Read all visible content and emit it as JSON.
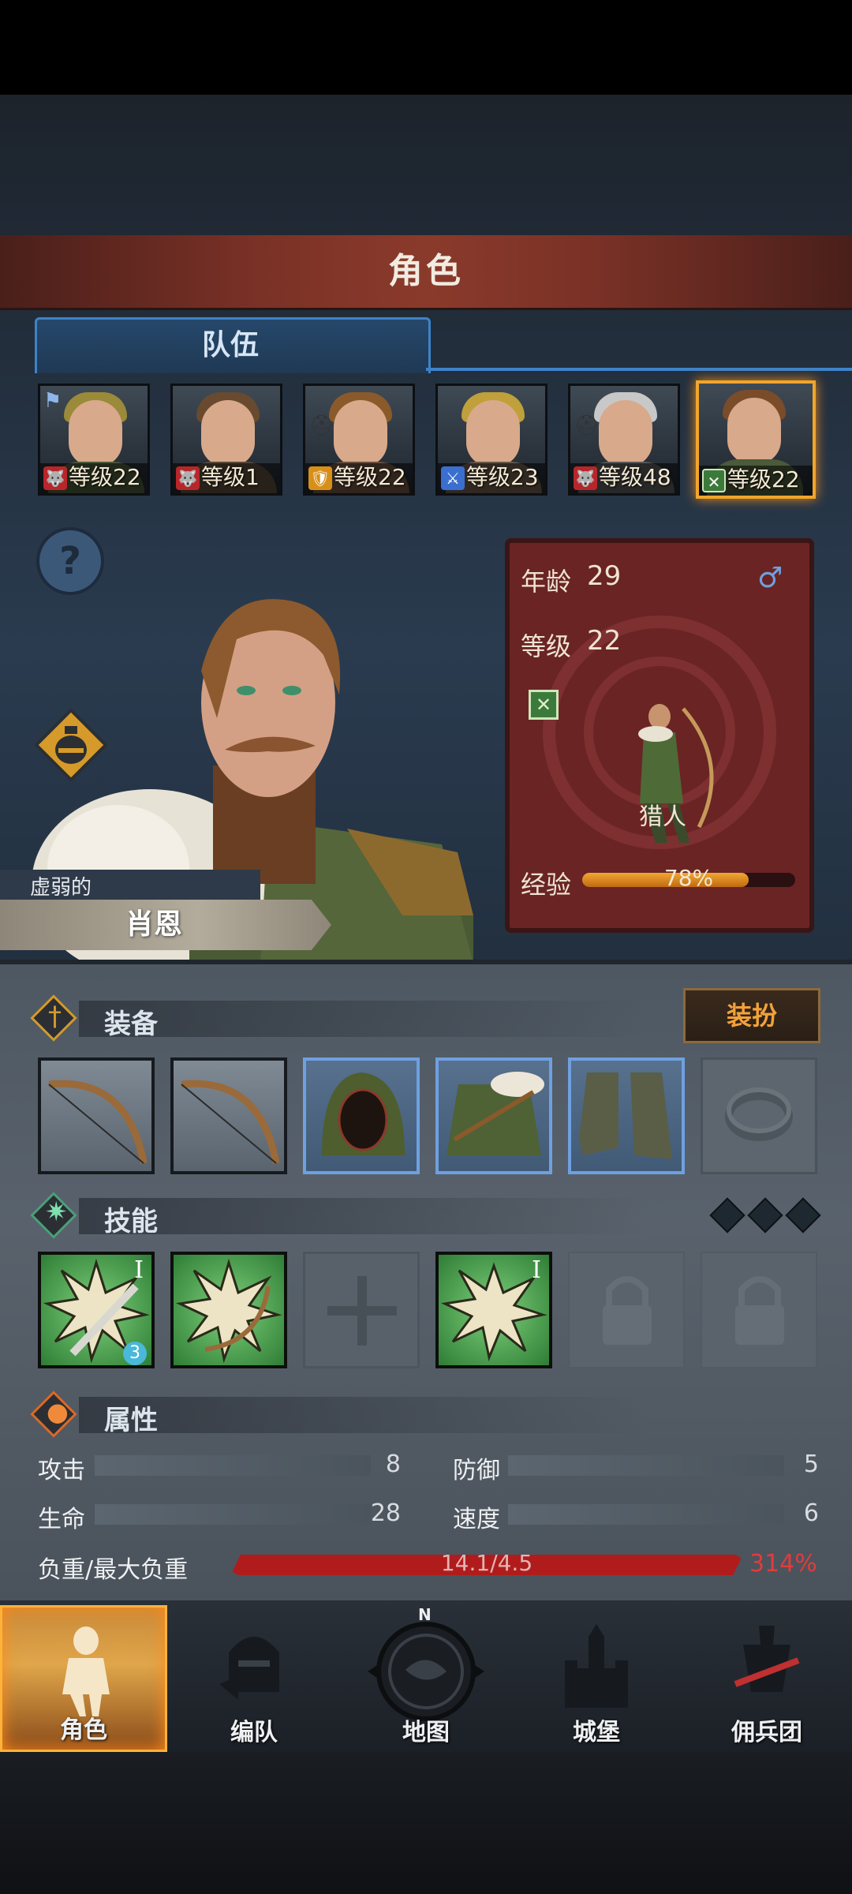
{
  "header": {
    "title": "角色"
  },
  "team_tab": {
    "label": "队伍"
  },
  "roster": [
    {
      "level_label": "等级22",
      "class_color": "#b8262a",
      "class_glyph": "🐺",
      "hair": "#9a8a3a",
      "flag": true
    },
    {
      "level_label": "等级1",
      "class_color": "#b8262a",
      "class_glyph": "🐺",
      "hair": "#6a4a2e",
      "flag": false
    },
    {
      "level_label": "等级22",
      "class_color": "#d6901a",
      "class_glyph": "🛡",
      "hair": "#8a5a2a",
      "rank": true
    },
    {
      "level_label": "等级23",
      "class_color": "#3a6fd0",
      "class_glyph": "⚔",
      "hair": "#c0a03a",
      "flag": false
    },
    {
      "level_label": "等级48",
      "class_color": "#b8262a",
      "class_glyph": "🐺",
      "hair": "#c8c8c8",
      "rank": true
    },
    {
      "level_label": "等级22",
      "class_color": "#3c7a3c",
      "class_glyph": "✕",
      "hair": "#7a4c2a",
      "selected": true
    }
  ],
  "character": {
    "trait": "虚弱的",
    "name": "肖恩",
    "age_label": "年龄",
    "age": "29",
    "level_label": "等级",
    "level": "22",
    "gender_icon": "♂",
    "class_name": "猎人",
    "xp_label": "经验",
    "xp_text": "78%",
    "xp_fraction": 0.78
  },
  "equipment": {
    "title": "装备",
    "dress_button": "装扮",
    "slots": [
      "bow",
      "bow",
      "hood",
      "fur-armor",
      "boots",
      "ring"
    ]
  },
  "skills": {
    "title": "技能",
    "charges": 3,
    "first_badge": "3",
    "roman": "I"
  },
  "attributes": {
    "title": "属性",
    "attack_label": "攻击",
    "attack": "8",
    "defense_label": "防御",
    "defense": "5",
    "life_label": "生命",
    "life": "28",
    "speed_label": "速度",
    "speed": "6",
    "load_label": "负重/最大负重",
    "load_text": "14.1/4.5",
    "load_pct": "314%"
  },
  "nav": [
    {
      "label": "角色",
      "active": true
    },
    {
      "label": "编队"
    },
    {
      "label": "地图",
      "compass": "N"
    },
    {
      "label": "城堡"
    },
    {
      "label": "佣兵团"
    }
  ]
}
